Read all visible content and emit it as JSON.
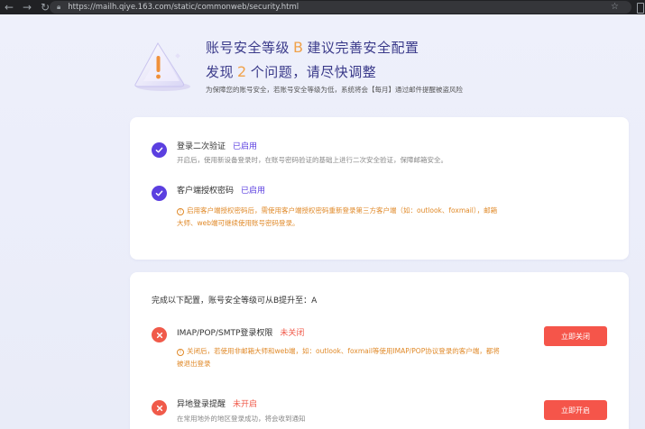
{
  "browser": {
    "url": "https://mailh.qiye.163.com/static/commonweb/security.html"
  },
  "header": {
    "title_prefix": "账号安全等级",
    "grade": "B",
    "title_suffix": "建议完善安全配置",
    "found_prefix": "发现",
    "issue_count": "2",
    "found_suffix": "个问题，请尽快调整",
    "subtitle": "为保障您的账号安全，若账号安全等级为低，系统将会【每月】通过邮件提醒被盗风险"
  },
  "enabled_items": [
    {
      "title": "登录二次验证",
      "status": "已启用",
      "desc": "开启后，使用新设备登录时，在账号密码验证的基础上进行二次安全验证，保障邮箱安全。"
    },
    {
      "title": "客户端授权密码",
      "status": "已启用",
      "warn_line1": "启用客户端授权密码后，需使用客户端授权密码重新登录第三方客户端（如：outlook、foxmail），邮箱",
      "warn_line2": "大师、web端可继续使用账号密码登录。"
    }
  ],
  "upgrade": {
    "heading": "完成以下配置，账号安全等级可从B提升至：A",
    "items": [
      {
        "title": "IMAP/POP/SMTP登录权限",
        "status": "未关闭",
        "warn_line1": "关闭后，若使用非邮箱大师和web端，如：outlook、foxmail等使用IMAP/POP协议登录的客户端，都将",
        "warn_line2": "被退出登录",
        "button": "立即关闭"
      },
      {
        "title": "异地登录提醒",
        "status": "未开启",
        "desc": "在常用地外的地区登录成功，将会收到通知",
        "button": "立即开启"
      }
    ]
  },
  "colors": {
    "accent": "#5b3fe0",
    "danger": "#f05a4a",
    "warning": "#e08a2a",
    "title": "#3a3a8a"
  }
}
